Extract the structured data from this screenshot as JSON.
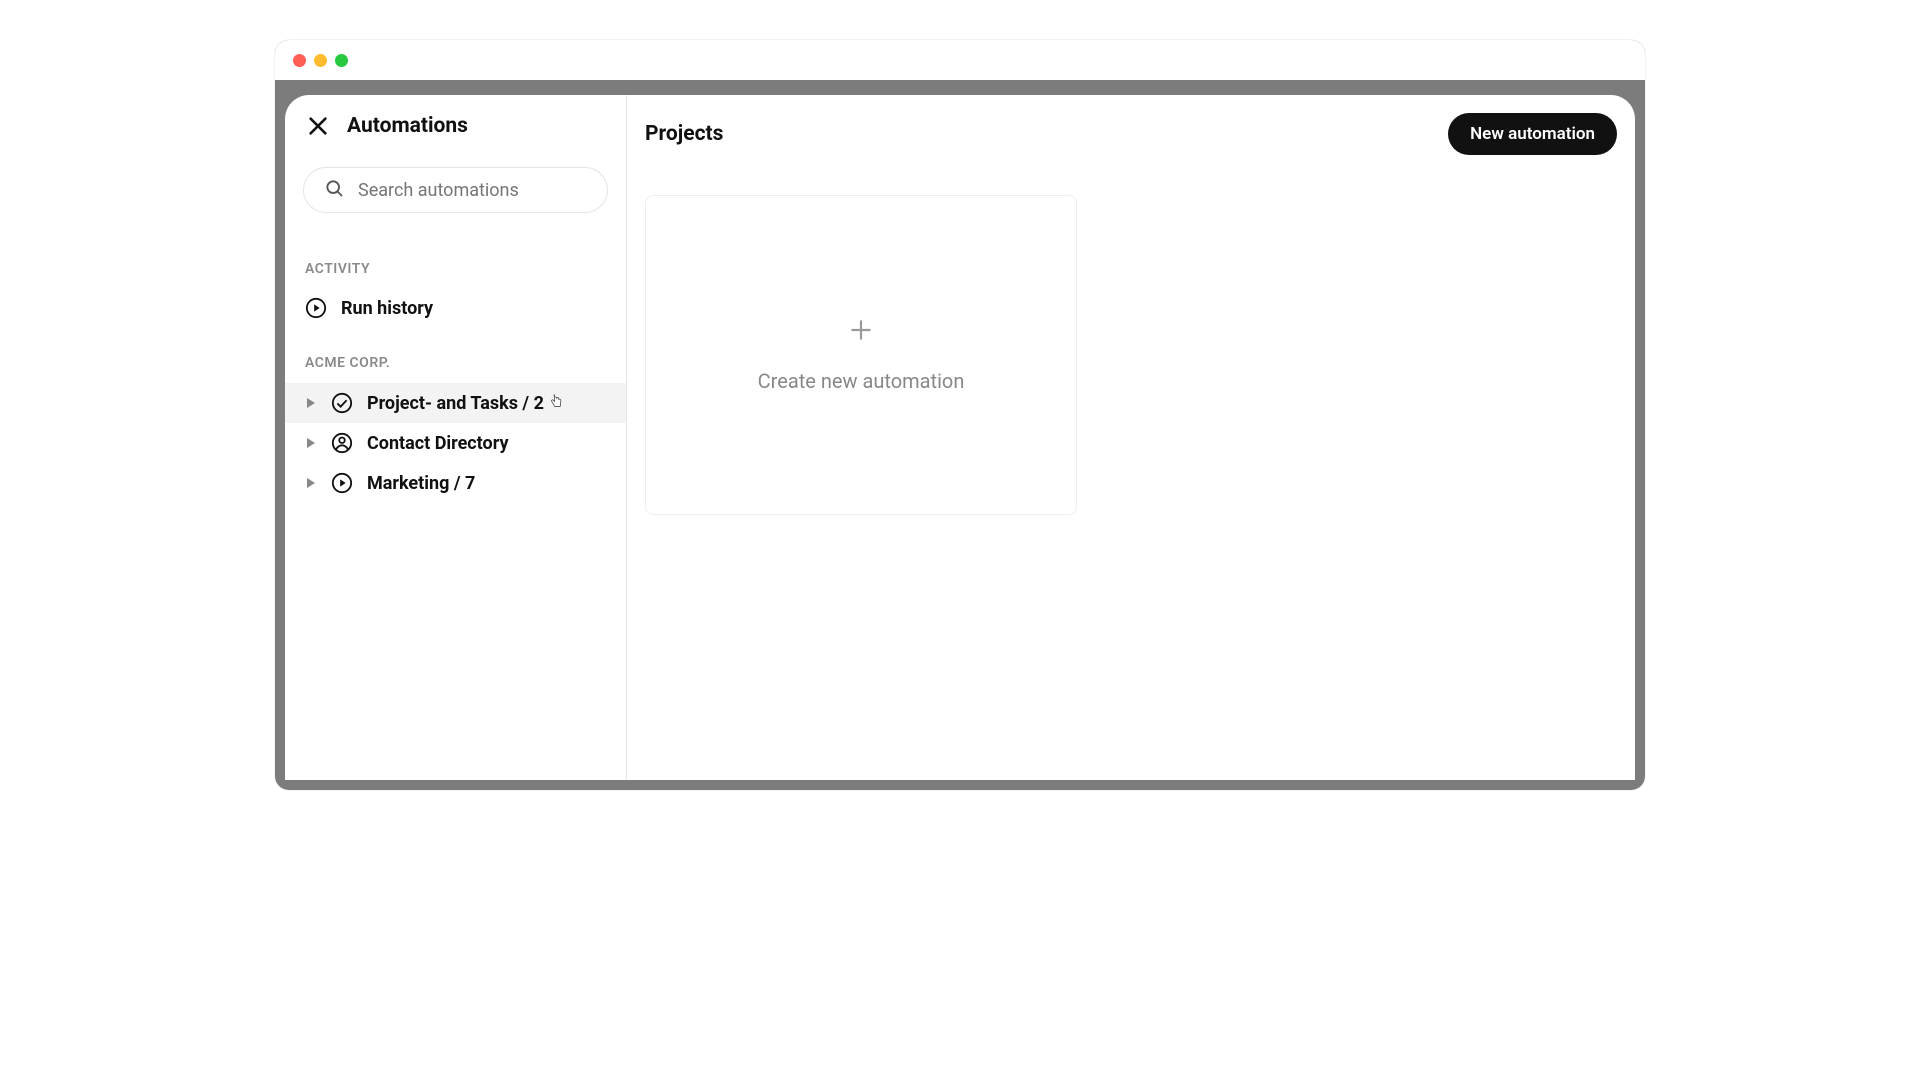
{
  "window": {
    "traffic_lights": [
      "close",
      "minimize",
      "zoom"
    ]
  },
  "sidebar": {
    "title": "Automations",
    "search_placeholder": "Search automations",
    "sections": {
      "activity": {
        "label": "ACTIVITY",
        "run_history": "Run history"
      },
      "workspace": {
        "label": "ACME CORP.",
        "items": [
          {
            "label": "Project- and Tasks / 2",
            "icon": "check-circle"
          },
          {
            "label": "Contact Directory",
            "icon": "user-circle"
          },
          {
            "label": "Marketing / 7",
            "icon": "play-circle"
          }
        ]
      }
    }
  },
  "main": {
    "title": "Projects",
    "new_button": "New automation",
    "create_card": "Create new automation"
  }
}
